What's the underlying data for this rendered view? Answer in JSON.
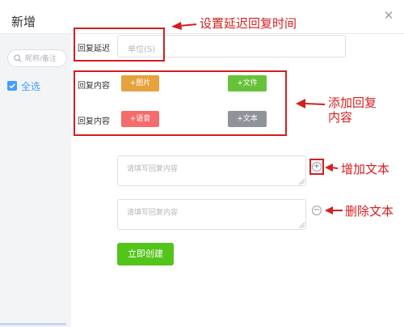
{
  "dialog": {
    "title": "新增",
    "close_icon": "close-icon"
  },
  "sidebar": {
    "search_placeholder": "昵称/备注",
    "select_all_label": "全选",
    "select_all_checked": true
  },
  "form": {
    "delay_label": "回复延迟",
    "delay_placeholder": "单位(S)",
    "content_label_1": "回复内容",
    "content_label_2": "回复内容",
    "buttons": {
      "image": "+图片",
      "file": "+文件",
      "voice": "+语音",
      "text": "+文本"
    },
    "textarea_placeholder_1": "请填写回复内容",
    "textarea_placeholder_2": "请填写回复内容",
    "add_text_icon": "plus-circle-icon",
    "remove_text_icon": "minus-circle-icon",
    "submit_label": "立即创建"
  },
  "annotations": {
    "delay": "设置延迟回复时间",
    "add_reply_line1": "添加回复",
    "add_reply_line2": "内容",
    "add_text": "增加文本",
    "remove_text": "删除文本"
  },
  "colors": {
    "annotation_red": "#d21f1f",
    "primary_blue": "#409eff",
    "image_orange": "#e6a23c",
    "file_green": "#67c23a",
    "voice_red": "#f56c6c",
    "text_gray": "#909399",
    "submit_green": "#52c41a"
  }
}
